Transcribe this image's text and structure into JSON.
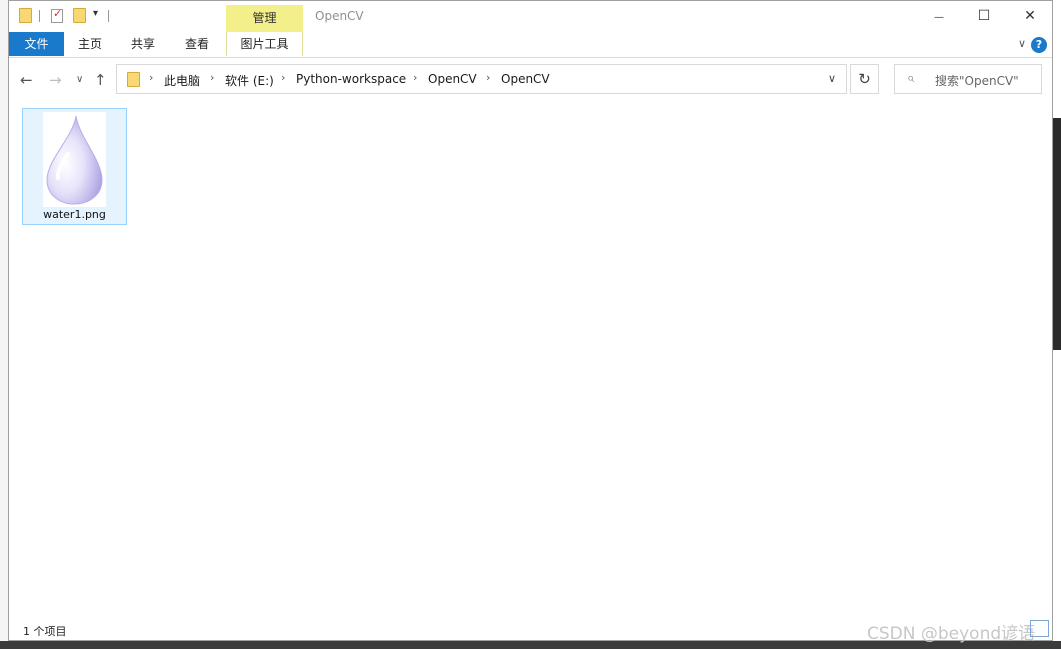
{
  "window": {
    "title": "OpenCV",
    "contextual_tab_group": "管理",
    "minimize_glyph": "—",
    "maximize_glyph": "☐",
    "close_glyph": "✕"
  },
  "ribbon": {
    "tabs": [
      "文件",
      "主页",
      "共享",
      "查看",
      "图片工具"
    ],
    "help_glyph": "?",
    "collapse_glyph": "∨"
  },
  "navigation": {
    "back_glyph": "←",
    "forward_glyph": "→",
    "recent_glyph": "∨",
    "up_glyph": "↑",
    "breadcrumb": [
      "此电脑",
      "软件 (E:)",
      "Python-workspace",
      "OpenCV",
      "OpenCV"
    ],
    "separator_glyph": "›",
    "dropdown_glyph": "∨",
    "refresh_glyph": "↻"
  },
  "search": {
    "placeholder": "搜索\"OpenCV\"",
    "icon": "search-icon"
  },
  "files": [
    {
      "name": "water1.png",
      "thumbnail": "water-drop-image",
      "selected": true
    }
  ],
  "status": {
    "item_count": "1 个项目"
  },
  "watermark": "CSDN @beyond谚语",
  "colors": {
    "file_tab_bg": "#1979ca",
    "manage_tab_bg": "#f3ef8b",
    "selection_bg": "#e5f3ff",
    "selection_border": "#99d1ff"
  }
}
